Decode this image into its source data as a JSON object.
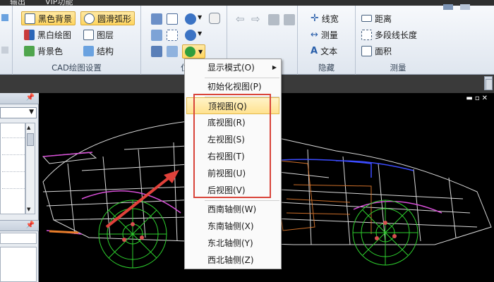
{
  "tabs": {
    "export": "输出",
    "vip": "VIP功能"
  },
  "ribbon": {
    "cad_group": {
      "label": "CAD绘图设置",
      "black_bg": "黑色背景",
      "smooth_arc": "圆滑弧形",
      "bw_draw": "黑白绘图",
      "layers": "图层",
      "bg_color": "背景色",
      "structure": "结构"
    },
    "position_group": {
      "label": "位"
    },
    "hide_group": {
      "label": "隐藏",
      "line_width": "线宽",
      "measure": "测量",
      "text": "文本"
    },
    "measure_group": {
      "label": "测量",
      "distance": "距离",
      "polyline_length": "多段线长度",
      "area": "面积"
    }
  },
  "menu": {
    "display_mode": "显示模式(O)",
    "init_view": "初始化视图(P)",
    "top_view": "顶视图(Q)",
    "bottom_view": "底视图(R)",
    "left_view": "左视图(S)",
    "right_view": "右视图(T)",
    "front_view": "前视图(U)",
    "back_view": "后视图(V)",
    "sw_iso": "西南轴侧(W)",
    "se_iso": "东南轴侧(X)",
    "ne_iso": "东北轴侧(Y)",
    "nw_iso": "西北轴侧(Z)"
  },
  "colors": {
    "highlight": "#ffe28f",
    "annotation_red": "#d9443a",
    "wheel_green": "#2ed12e",
    "wire_white": "#ffffff"
  }
}
